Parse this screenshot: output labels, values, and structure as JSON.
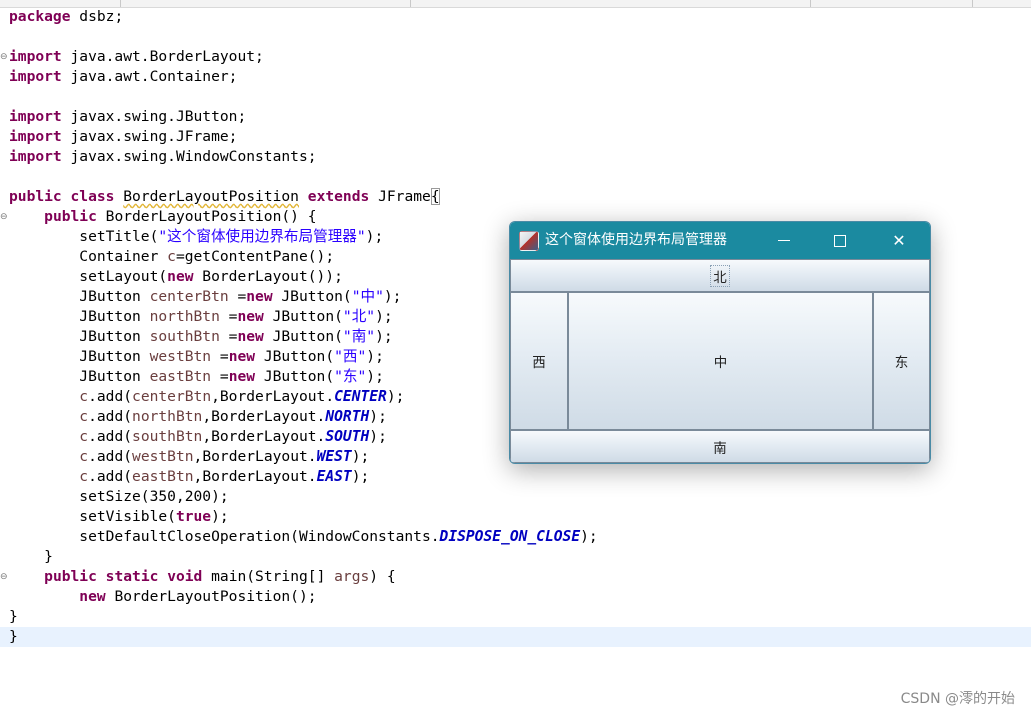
{
  "editor": {
    "lines": [
      {
        "segments": [
          {
            "t": "package",
            "c": "kw"
          },
          {
            "t": " dsbz;",
            "c": ""
          }
        ]
      },
      {
        "segments": []
      },
      {
        "fold": "⊖",
        "segments": [
          {
            "t": "import",
            "c": "kw"
          },
          {
            "t": " java.awt.BorderLayout;",
            "c": ""
          }
        ]
      },
      {
        "segments": [
          {
            "t": "import",
            "c": "kw"
          },
          {
            "t": " java.awt.Container;",
            "c": ""
          }
        ]
      },
      {
        "segments": []
      },
      {
        "segments": [
          {
            "t": "import",
            "c": "kw"
          },
          {
            "t": " javax.swing.JButton;",
            "c": ""
          }
        ]
      },
      {
        "segments": [
          {
            "t": "import",
            "c": "kw"
          },
          {
            "t": " javax.swing.JFrame;",
            "c": ""
          }
        ]
      },
      {
        "segments": [
          {
            "t": "import",
            "c": "kw"
          },
          {
            "t": " javax.swing.WindowConstants;",
            "c": ""
          }
        ]
      },
      {
        "segments": []
      },
      {
        "segments": [
          {
            "t": "public",
            "c": "kw"
          },
          {
            "t": " ",
            "c": ""
          },
          {
            "t": "class",
            "c": "kw"
          },
          {
            "t": " ",
            "c": ""
          },
          {
            "t": "BorderLayoutPosition",
            "c": "warn"
          },
          {
            "t": " ",
            "c": ""
          },
          {
            "t": "extends",
            "c": "kw"
          },
          {
            "t": " JFrame",
            "c": ""
          },
          {
            "t": "{",
            "c": "bracket"
          }
        ]
      },
      {
        "fold": "⊖",
        "segments": [
          {
            "t": "    ",
            "c": ""
          },
          {
            "t": "public",
            "c": "kw"
          },
          {
            "t": " BorderLayoutPosition() {",
            "c": ""
          }
        ]
      },
      {
        "segments": [
          {
            "t": "        setTitle(",
            "c": ""
          },
          {
            "t": "\"这个窗体使用边界布局管理器\"",
            "c": "str"
          },
          {
            "t": ");",
            "c": ""
          }
        ]
      },
      {
        "segments": [
          {
            "t": "        Container ",
            "c": ""
          },
          {
            "t": "c",
            "c": "vr"
          },
          {
            "t": "=getContentPane();",
            "c": ""
          }
        ]
      },
      {
        "segments": [
          {
            "t": "        setLayout(",
            "c": ""
          },
          {
            "t": "new",
            "c": "kw"
          },
          {
            "t": " BorderLayout());",
            "c": ""
          }
        ]
      },
      {
        "segments": [
          {
            "t": "        JButton ",
            "c": ""
          },
          {
            "t": "centerBtn",
            "c": "vr"
          },
          {
            "t": " =",
            "c": ""
          },
          {
            "t": "new",
            "c": "kw"
          },
          {
            "t": " JButton(",
            "c": ""
          },
          {
            "t": "\"中\"",
            "c": "str"
          },
          {
            "t": ");",
            "c": ""
          }
        ]
      },
      {
        "segments": [
          {
            "t": "        JButton ",
            "c": ""
          },
          {
            "t": "northBtn",
            "c": "vr"
          },
          {
            "t": " =",
            "c": ""
          },
          {
            "t": "new",
            "c": "kw"
          },
          {
            "t": " JButton(",
            "c": ""
          },
          {
            "t": "\"北\"",
            "c": "str"
          },
          {
            "t": ");",
            "c": ""
          }
        ]
      },
      {
        "segments": [
          {
            "t": "        JButton ",
            "c": ""
          },
          {
            "t": "southBtn",
            "c": "vr"
          },
          {
            "t": " =",
            "c": ""
          },
          {
            "t": "new",
            "c": "kw"
          },
          {
            "t": " JButton(",
            "c": ""
          },
          {
            "t": "\"南\"",
            "c": "str"
          },
          {
            "t": ");",
            "c": ""
          }
        ]
      },
      {
        "segments": [
          {
            "t": "        JButton ",
            "c": ""
          },
          {
            "t": "westBtn",
            "c": "vr"
          },
          {
            "t": " =",
            "c": ""
          },
          {
            "t": "new",
            "c": "kw"
          },
          {
            "t": " JButton(",
            "c": ""
          },
          {
            "t": "\"西\"",
            "c": "str"
          },
          {
            "t": ");",
            "c": ""
          }
        ]
      },
      {
        "segments": [
          {
            "t": "        JButton ",
            "c": ""
          },
          {
            "t": "eastBtn",
            "c": "vr"
          },
          {
            "t": " =",
            "c": ""
          },
          {
            "t": "new",
            "c": "kw"
          },
          {
            "t": " JButton(",
            "c": ""
          },
          {
            "t": "\"东\"",
            "c": "str"
          },
          {
            "t": ");",
            "c": ""
          }
        ]
      },
      {
        "segments": [
          {
            "t": "        ",
            "c": ""
          },
          {
            "t": "c",
            "c": "vr"
          },
          {
            "t": ".add(",
            "c": ""
          },
          {
            "t": "centerBtn",
            "c": "vr"
          },
          {
            "t": ",BorderLayout.",
            "c": ""
          },
          {
            "t": "CENTER",
            "c": "cst"
          },
          {
            "t": ");",
            "c": ""
          }
        ]
      },
      {
        "segments": [
          {
            "t": "        ",
            "c": ""
          },
          {
            "t": "c",
            "c": "vr"
          },
          {
            "t": ".add(",
            "c": ""
          },
          {
            "t": "northBtn",
            "c": "vr"
          },
          {
            "t": ",BorderLayout.",
            "c": ""
          },
          {
            "t": "NORTH",
            "c": "cst"
          },
          {
            "t": ");",
            "c": ""
          }
        ]
      },
      {
        "segments": [
          {
            "t": "        ",
            "c": ""
          },
          {
            "t": "c",
            "c": "vr"
          },
          {
            "t": ".add(",
            "c": ""
          },
          {
            "t": "southBtn",
            "c": "vr"
          },
          {
            "t": ",BorderLayout.",
            "c": ""
          },
          {
            "t": "SOUTH",
            "c": "cst"
          },
          {
            "t": ");",
            "c": ""
          }
        ]
      },
      {
        "segments": [
          {
            "t": "        ",
            "c": ""
          },
          {
            "t": "c",
            "c": "vr"
          },
          {
            "t": ".add(",
            "c": ""
          },
          {
            "t": "westBtn",
            "c": "vr"
          },
          {
            "t": ",BorderLayout.",
            "c": ""
          },
          {
            "t": "WEST",
            "c": "cst"
          },
          {
            "t": ");",
            "c": ""
          }
        ]
      },
      {
        "segments": [
          {
            "t": "        ",
            "c": ""
          },
          {
            "t": "c",
            "c": "vr"
          },
          {
            "t": ".add(",
            "c": ""
          },
          {
            "t": "eastBtn",
            "c": "vr"
          },
          {
            "t": ",BorderLayout.",
            "c": ""
          },
          {
            "t": "EAST",
            "c": "cst"
          },
          {
            "t": ");",
            "c": ""
          }
        ]
      },
      {
        "segments": [
          {
            "t": "        setSize(350,200);",
            "c": ""
          }
        ]
      },
      {
        "segments": [
          {
            "t": "        setVisible(",
            "c": ""
          },
          {
            "t": "true",
            "c": "kw"
          },
          {
            "t": ");",
            "c": ""
          }
        ]
      },
      {
        "segments": [
          {
            "t": "        setDefaultCloseOperation(WindowConstants.",
            "c": ""
          },
          {
            "t": "DISPOSE_ON_CLOSE",
            "c": "cst"
          },
          {
            "t": ");",
            "c": ""
          }
        ]
      },
      {
        "segments": [
          {
            "t": "    }",
            "c": ""
          }
        ]
      },
      {
        "fold": "⊖",
        "segments": [
          {
            "t": "    ",
            "c": ""
          },
          {
            "t": "public",
            "c": "kw"
          },
          {
            "t": " ",
            "c": ""
          },
          {
            "t": "static",
            "c": "kw"
          },
          {
            "t": " ",
            "c": ""
          },
          {
            "t": "void",
            "c": "kw"
          },
          {
            "t": " main(String[] ",
            "c": ""
          },
          {
            "t": "args",
            "c": "vr"
          },
          {
            "t": ") {",
            "c": ""
          }
        ]
      },
      {
        "segments": [
          {
            "t": "        ",
            "c": ""
          },
          {
            "t": "new",
            "c": "kw"
          },
          {
            "t": " BorderLayoutPosition();",
            "c": ""
          }
        ]
      },
      {
        "segments": [
          {
            "t": "}",
            "c": ""
          }
        ]
      },
      {
        "current": true,
        "segments": [
          {
            "t": "}",
            "c": ""
          }
        ]
      }
    ]
  },
  "window": {
    "title": "这个窗体使用边界布局管理器",
    "minimize_glyph": "—",
    "maximize_glyph": "☐",
    "close_glyph": "✕",
    "buttons": {
      "north": "北",
      "west": "西",
      "center": "中",
      "east": "东",
      "south": "南"
    }
  },
  "watermark": "CSDN @澪的开始",
  "colors": {
    "keyword": "#7f0055",
    "string": "#2a00ff",
    "constant": "#0000c0",
    "titlebar": "#1b8aa0"
  }
}
